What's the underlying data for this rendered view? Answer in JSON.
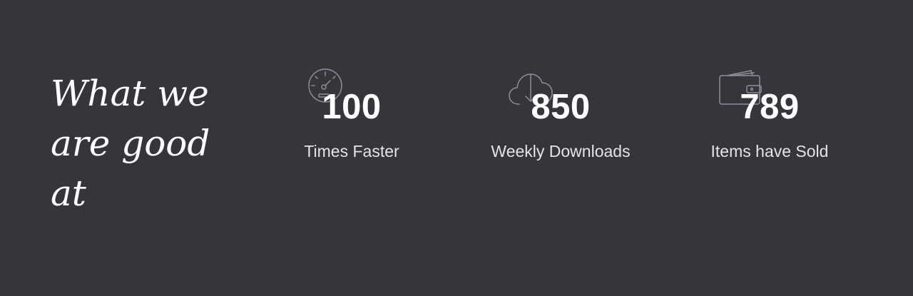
{
  "heading": "What we are good at",
  "stats": [
    {
      "number": "100",
      "label": "Times Faster",
      "icon": "speedometer-icon"
    },
    {
      "number": "850",
      "label": "Weekly Downloads",
      "icon": "cloud-download-icon"
    },
    {
      "number": "789",
      "label": "Items have Sold",
      "icon": "wallet-icon"
    }
  ],
  "colors": {
    "background": "#35363c",
    "text": "#ffffff",
    "icon_stroke": "#8e8f96"
  }
}
